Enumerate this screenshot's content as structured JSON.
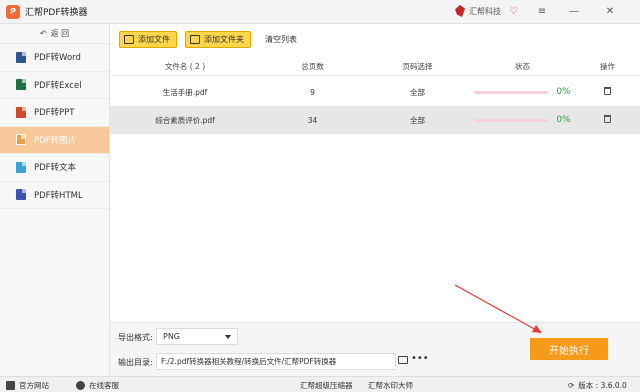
{
  "app": {
    "logo_letter": "P",
    "title": "汇帮PDF转换器",
    "brand": "汇帮科技"
  },
  "sidebar": {
    "back_label": "返 回",
    "items": [
      {
        "label": "PDF转Word",
        "color": "#2b5797",
        "active": false
      },
      {
        "label": "PDF转Excel",
        "color": "#1e7145",
        "active": false
      },
      {
        "label": "PDF转PPT",
        "color": "#d24726",
        "active": false
      },
      {
        "label": "PDF转图片",
        "color": "#e8a14a",
        "active": true
      },
      {
        "label": "PDF转文本",
        "color": "#3aa0d8",
        "active": false
      },
      {
        "label": "PDF转HTML",
        "color": "#3f51b5",
        "active": false
      }
    ]
  },
  "toolbar": {
    "add_file": "添加文件",
    "add_folder": "添加文件夹",
    "clear_list": "清空列表"
  },
  "table": {
    "headers": [
      "文件名 ( 2 )",
      "总页数",
      "页码选择",
      "状态",
      "操作"
    ],
    "rows": [
      {
        "name": "生活手册.pdf",
        "pages": "9",
        "selection": "全部",
        "progress": 0,
        "percent": "0%"
      },
      {
        "name": "综合素质评价.pdf",
        "pages": "34",
        "selection": "全部",
        "progress": 0,
        "percent": "0%"
      }
    ]
  },
  "output": {
    "format_label": "导出格式:",
    "format_value": "PNG",
    "dir_label": "输出目录:",
    "dir_value": "F:/2.pdf转换器相关教程/转换后文件/汇帮PDF转换器",
    "more": "•••"
  },
  "start_button": "开始执行",
  "statusbar": {
    "website": "官方网站",
    "support": "在线客服",
    "compressor": "汇帮超级压缩器",
    "watermark": "汇帮水印大师",
    "version": "版本 : 3.6.0.0"
  }
}
